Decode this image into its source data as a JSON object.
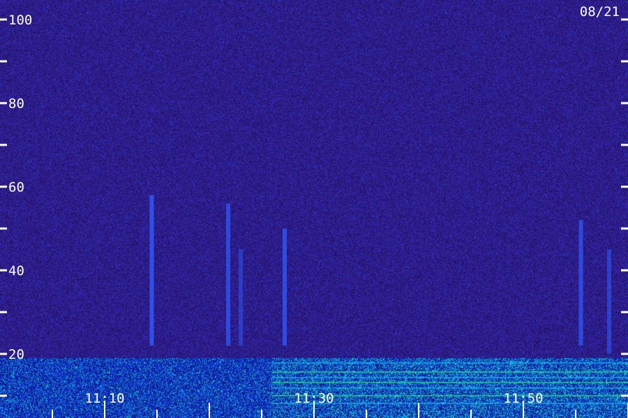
{
  "date_label": "08/21",
  "colors": {
    "background": "#2a1670",
    "noise_low": "#24105f",
    "noise_high": "#3d23a0",
    "signal_blue": "#2f5cff",
    "signal_cyan": "#19c8ff",
    "signal_green": "#2bff8a",
    "axis": "#ffffff"
  },
  "chart_data": {
    "type": "heatmap",
    "title": "",
    "xlabel": "",
    "ylabel": "",
    "ylim": [
      0,
      100
    ],
    "y_ticks_major": [
      20,
      40,
      60,
      80,
      100
    ],
    "y_ticks_minor": [
      10,
      30,
      50,
      70,
      90
    ],
    "y_tick_labels": [
      "20",
      "40",
      "60",
      "80",
      "100"
    ],
    "x_tick_labels": [
      {
        "label": "11:10",
        "minute": 10
      },
      {
        "label": "11:30",
        "minute": 30
      },
      {
        "label": "11:50",
        "minute": 50
      }
    ],
    "xlim_minutes": [
      2,
      62
    ],
    "vertical_features": [
      {
        "minute": 14.5,
        "top": 58,
        "bottom": 22,
        "intensity": 0.8
      },
      {
        "minute": 21.8,
        "top": 56,
        "bottom": 22,
        "intensity": 0.7
      },
      {
        "minute": 23.0,
        "top": 45,
        "bottom": 22,
        "intensity": 0.5
      },
      {
        "minute": 27.2,
        "top": 50,
        "bottom": 22,
        "intensity": 0.75
      },
      {
        "minute": 55.5,
        "top": 52,
        "bottom": 22,
        "intensity": 0.7
      },
      {
        "minute": 58.2,
        "top": 45,
        "bottom": 20,
        "intensity": 0.55
      }
    ],
    "low_band": {
      "top": 19,
      "bottom": 0,
      "strong_from_minute": 26
    }
  }
}
